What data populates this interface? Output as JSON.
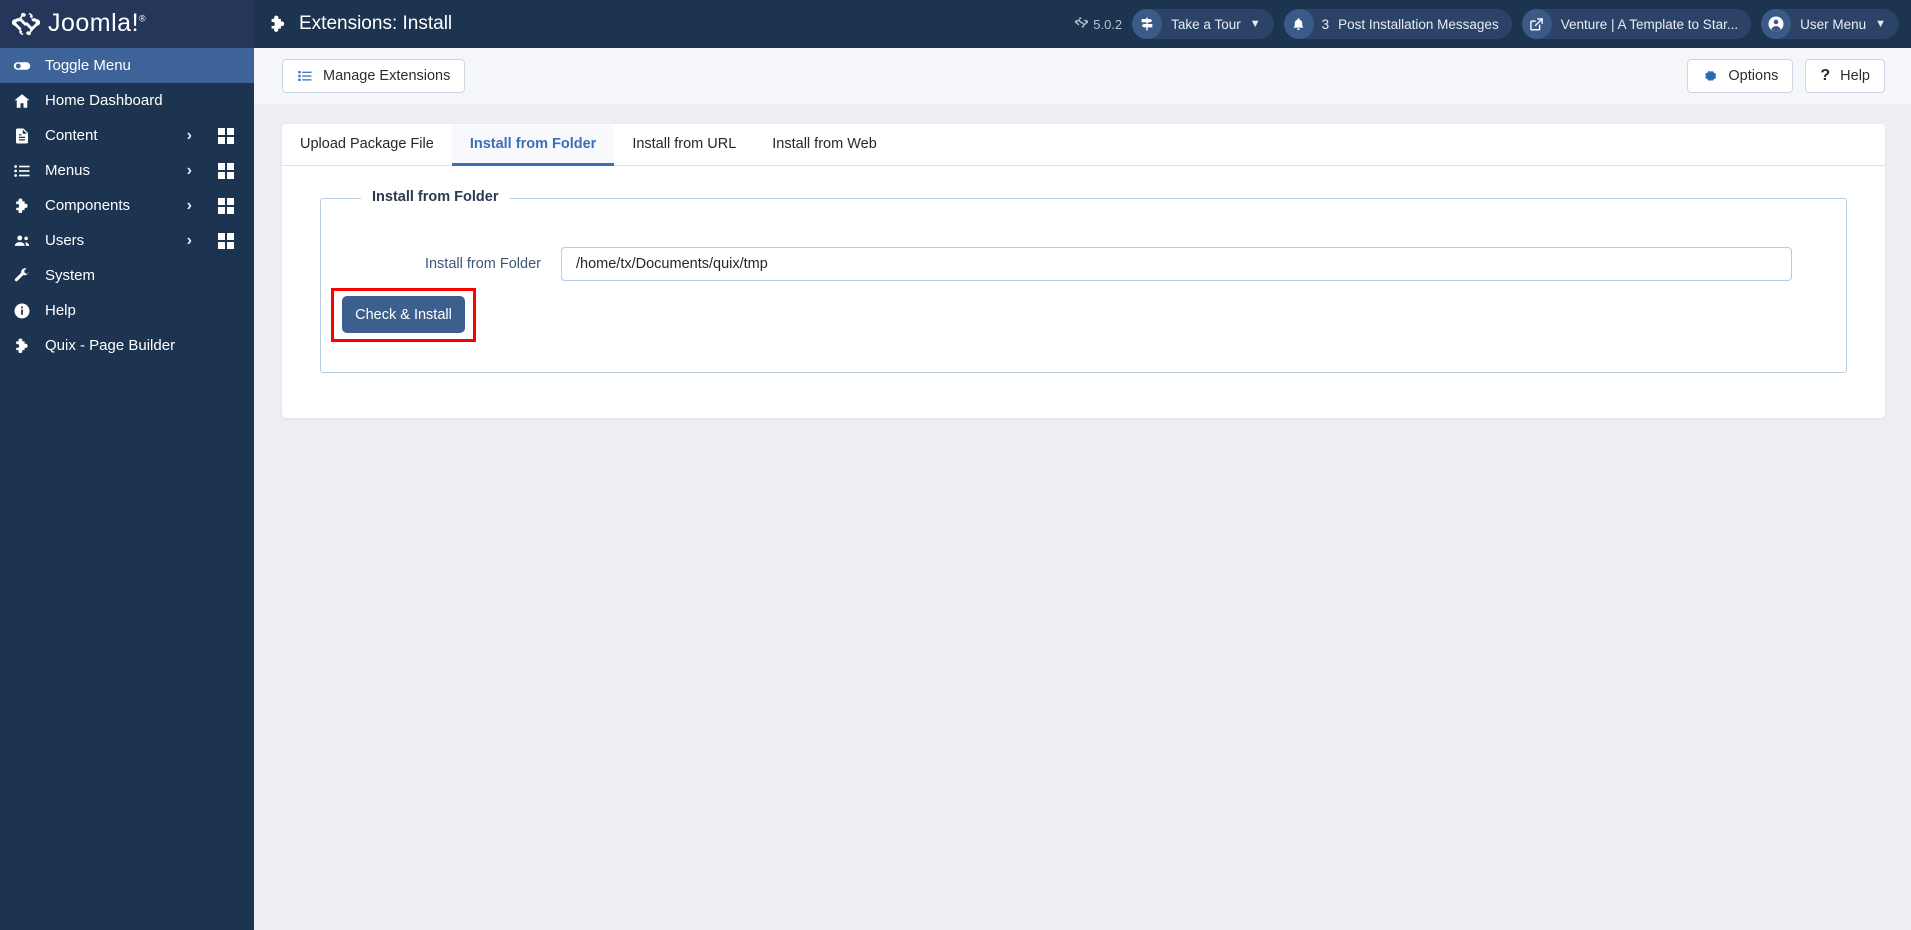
{
  "brand": {
    "name": "Joomla!",
    "trademark": "®",
    "icon": "joomla-logo-icon"
  },
  "sidebar": {
    "items": [
      {
        "label": "Toggle Menu",
        "icon": "toggle-icon",
        "active": true,
        "chevron": false,
        "grid": false
      },
      {
        "label": "Home Dashboard",
        "icon": "home-icon",
        "active": false,
        "chevron": false,
        "grid": false
      },
      {
        "label": "Content",
        "icon": "document-icon",
        "active": false,
        "chevron": true,
        "grid": true
      },
      {
        "label": "Menus",
        "icon": "list-icon",
        "active": false,
        "chevron": true,
        "grid": true
      },
      {
        "label": "Components",
        "icon": "puzzle-icon",
        "active": false,
        "chevron": true,
        "grid": true
      },
      {
        "label": "Users",
        "icon": "users-icon",
        "active": false,
        "chevron": true,
        "grid": true
      },
      {
        "label": "System",
        "icon": "wrench-icon",
        "active": false,
        "chevron": false,
        "grid": false
      },
      {
        "label": "Help",
        "icon": "info-icon",
        "active": false,
        "chevron": false,
        "grid": false
      },
      {
        "label": "Quix - Page Builder",
        "icon": "puzzle-icon",
        "active": false,
        "chevron": false,
        "grid": false
      }
    ]
  },
  "header": {
    "title": "Extensions: Install",
    "title_icon": "puzzle-icon",
    "version": "5.0.2",
    "version_icon": "joomla-mark-icon",
    "take_a_tour": {
      "label": "Take a Tour",
      "icon": "signpost-icon",
      "caret": "chevron-down-icon"
    },
    "post_install": {
      "label": "Post Installation Messages",
      "count": "3",
      "icon": "bell-icon"
    },
    "template": {
      "label": "Venture | A Template to Star...",
      "icon": "external-link-icon"
    },
    "user_menu": {
      "label": "User Menu",
      "icon": "user-circle-icon",
      "caret": "chevron-down-icon"
    }
  },
  "toolbar": {
    "manage_extensions": {
      "label": "Manage Extensions",
      "icon": "list-icon"
    },
    "options": {
      "label": "Options",
      "icon": "gear-icon"
    },
    "help": {
      "label": "Help",
      "icon": "question-mark-icon"
    }
  },
  "tabs": [
    {
      "label": "Upload Package File",
      "active": false
    },
    {
      "label": "Install from Folder",
      "active": true
    },
    {
      "label": "Install from URL",
      "active": false
    },
    {
      "label": "Install from Web",
      "active": false
    }
  ],
  "form": {
    "legend": "Install from Folder",
    "field_label": "Install from Folder",
    "field_value": "/home/tx/Documents/quix/tmp",
    "field_placeholder": "",
    "submit_label": "Check & Install"
  },
  "colors": {
    "sidebar_bg": "#1c3450",
    "sidebar_active": "#3e6398",
    "header_bg": "#1c3450",
    "page_bg": "#eceef2",
    "accent_blue": "#3d6eb5",
    "primary_button": "#3d5f8d",
    "highlight_red": "#ff0000",
    "pill_bg": "#2b4367"
  }
}
